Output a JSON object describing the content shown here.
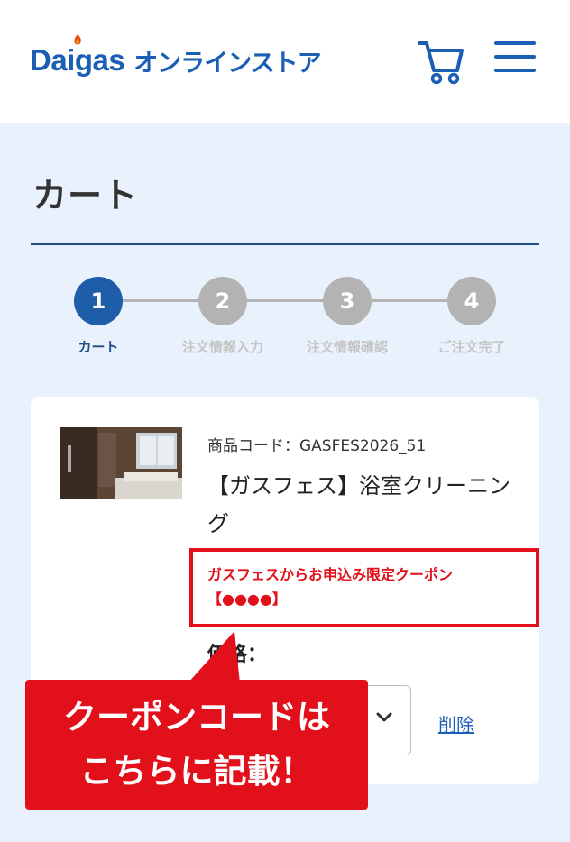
{
  "header": {
    "logo_brand": "Daigas",
    "logo_store": "オンラインストア",
    "icons": {
      "cart": "cart-icon",
      "menu": "hamburger-menu-icon"
    },
    "brand_color": "#1a5fb4"
  },
  "page": {
    "title": "カート"
  },
  "steps": [
    {
      "number": "1",
      "label": "カート",
      "active": true
    },
    {
      "number": "2",
      "label": "注文情報入力",
      "active": false
    },
    {
      "number": "3",
      "label": "注文情報確認",
      "active": false
    },
    {
      "number": "4",
      "label": "ご注文完了",
      "active": false
    }
  ],
  "product": {
    "code": "商品コード：GASFES2026_51",
    "name": "【ガスフェス】浴室クリーニング",
    "coupon_note": "ガスフェスからお申込み限定クーポン【●●●●】",
    "price_label": "価格：",
    "delete_label": "削除"
  },
  "callout": {
    "line1": "クーポンコードは",
    "line2": "こちらに記載！",
    "color": "#e2101a"
  }
}
